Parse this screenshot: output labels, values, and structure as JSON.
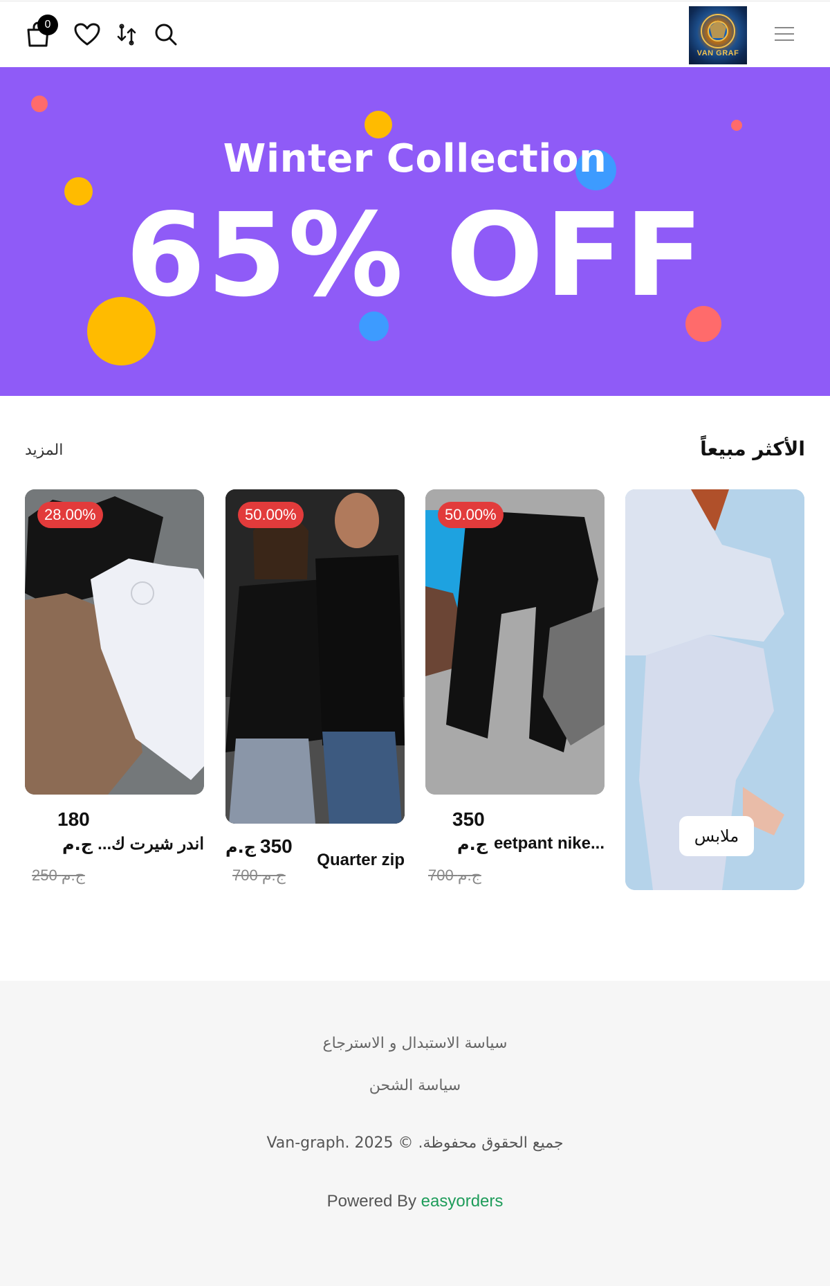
{
  "header": {
    "cart_count": "0",
    "logo_text": "VAN GRAF",
    "icons": [
      "cart-icon",
      "heart-icon",
      "compare-icon",
      "search-icon",
      "menu-icon"
    ]
  },
  "banner": {
    "subtitle": "Winter Collection",
    "headline": "65% OFF",
    "colors": {
      "background": "#8f5bf7",
      "yellow": "#ffbb00",
      "blue": "#3d9bff",
      "coral": "#ff6b6b"
    }
  },
  "section": {
    "title": "الأكثر مبيعاً",
    "more": "المزيد"
  },
  "category_card": {
    "label": "ملابس"
  },
  "products": [
    {
      "name": "اندر شيرت ك...",
      "price": "180",
      "currency": "ج.م",
      "old_price": "250 ج.م",
      "discount": "28.00%"
    },
    {
      "name": "Quarter zip",
      "price": "350",
      "currency": "ج.م",
      "old_price": "700 ج.م",
      "discount": "50.00%"
    },
    {
      "name": "...eetpant nike",
      "price": "350",
      "currency": "ج.م",
      "old_price": "700 ج.م",
      "discount": "50.00%"
    }
  ],
  "footer": {
    "link_exchange": "سياسة الاستبدال و الاسترجاع",
    "link_shipping": "سياسة الشحن",
    "copyright": "Van-graph. جميع الحقوق محفوظة. © 2025",
    "powered_prefix": "Powered By",
    "powered_brand": "easyorders"
  }
}
